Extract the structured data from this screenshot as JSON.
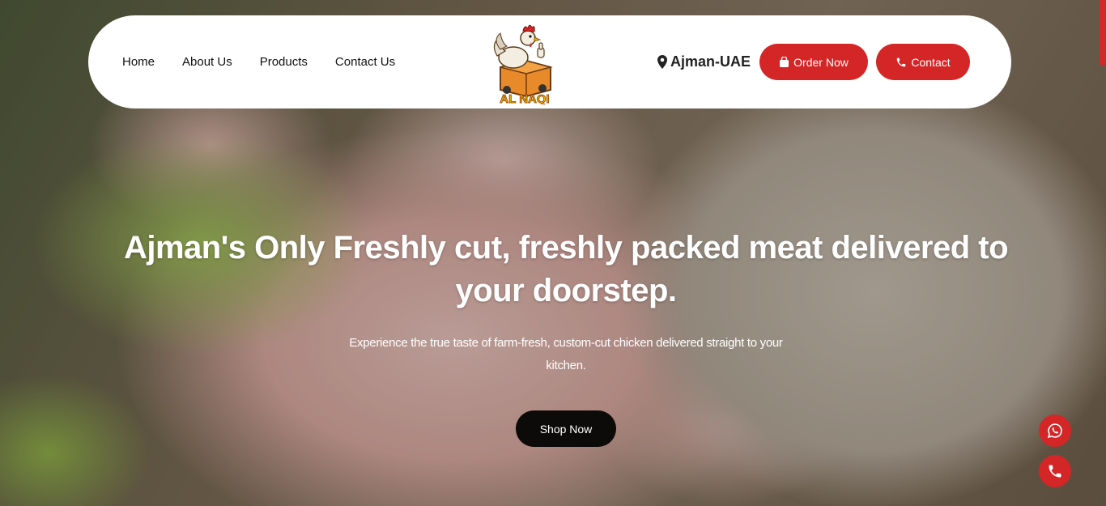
{
  "nav": {
    "links": [
      "Home",
      "About Us",
      "Products",
      "Contact Us"
    ],
    "logo_text": "AL NAQI",
    "location": "Ajman-UAE",
    "order_label": "Order Now",
    "contact_label": "Contact"
  },
  "hero": {
    "title": "Ajman's Only Freshly cut, freshly packed meat delivered to your doorstep.",
    "subtitle": "Experience the true taste of farm-fresh, custom-cut chicken delivered straight to your kitchen.",
    "cta_label": "Shop Now"
  },
  "floating": {
    "icons": [
      "whatsapp-icon",
      "phone-icon"
    ]
  },
  "colors": {
    "accent": "#d42626",
    "dark": "#0d0b09",
    "navbar_bg": "#ffffff"
  }
}
